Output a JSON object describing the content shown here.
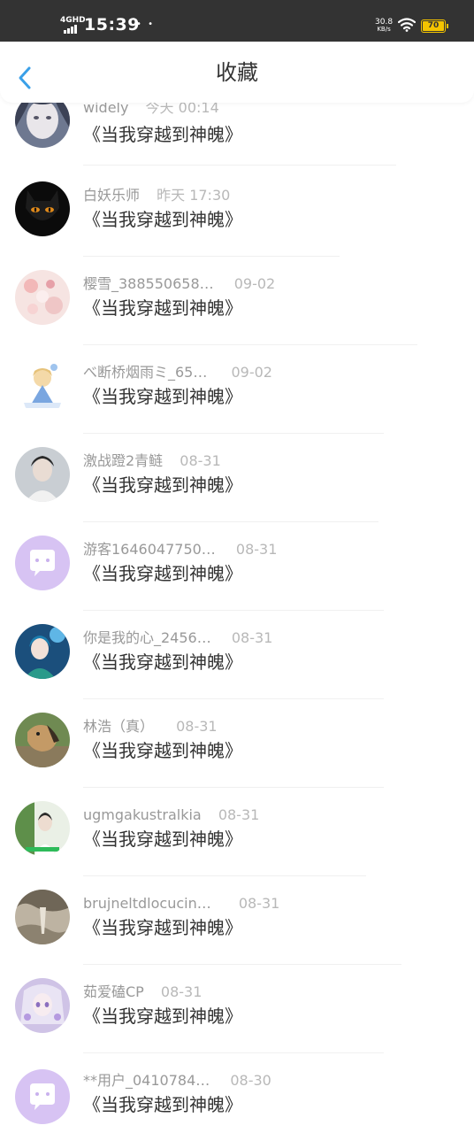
{
  "status_bar": {
    "network": "4GHD",
    "time": "15:39",
    "speed_value": "30.8",
    "speed_unit": "KB/s",
    "battery": "70",
    "icons": [
      "signal-icon",
      "wifi-icon",
      "battery-icon"
    ]
  },
  "nav": {
    "title": "收藏",
    "back_icon": "chevron-left-icon",
    "accent_color": "#3aa0e8"
  },
  "items": [
    {
      "name": "widely",
      "time": "今天 00:14",
      "title": "《当我穿越到神魄》",
      "avatar": "girl-portrait-avatar"
    },
    {
      "name": "白妖乐师",
      "time": "昨天 17:30",
      "title": "《当我穿越到神魄》",
      "avatar": "black-cat-avatar"
    },
    {
      "name": "樱雪_388550658…",
      "time": "09-02",
      "title": "《当我穿越到神魄》",
      "avatar": "pink-anime-avatar"
    },
    {
      "name": "べ断桥烟雨ミ_65…",
      "time": "09-02",
      "title": "《当我穿越到神魄》",
      "avatar": "chibi-avatar"
    },
    {
      "name": "激战蹬2青鲢",
      "time": "08-31",
      "title": "《当我穿越到神魄》",
      "avatar": "person-photo-avatar"
    },
    {
      "name": "游客1646047750…",
      "time": "08-31",
      "title": "《当我穿越到神魄》",
      "avatar": "default-chat-avatar"
    },
    {
      "name": "你是我的心_2456…",
      "time": "08-31",
      "title": "《当我穿越到神魄》",
      "avatar": "blue-anime-avatar"
    },
    {
      "name": "林浩（真）",
      "time": "08-31",
      "title": "《当我穿越到神魄》",
      "avatar": "dog-photo-avatar"
    },
    {
      "name": "ugmgakustralkia",
      "time": "08-31",
      "title": "《当我穿越到神魄》",
      "avatar": "green-photo-avatar"
    },
    {
      "name": "brujneltdlocucin…",
      "time": "08-31",
      "title": "《当我穿越到神魄》",
      "avatar": "scenery-avatar"
    },
    {
      "name": "茹爱磕CP",
      "time": "08-31",
      "title": "《当我穿越到神魄》",
      "avatar": "purple-anime-avatar"
    },
    {
      "name": "**用户_0410784…",
      "time": "08-30",
      "title": "《当我穿越到神魄》",
      "avatar": "default-chat-avatar"
    }
  ]
}
